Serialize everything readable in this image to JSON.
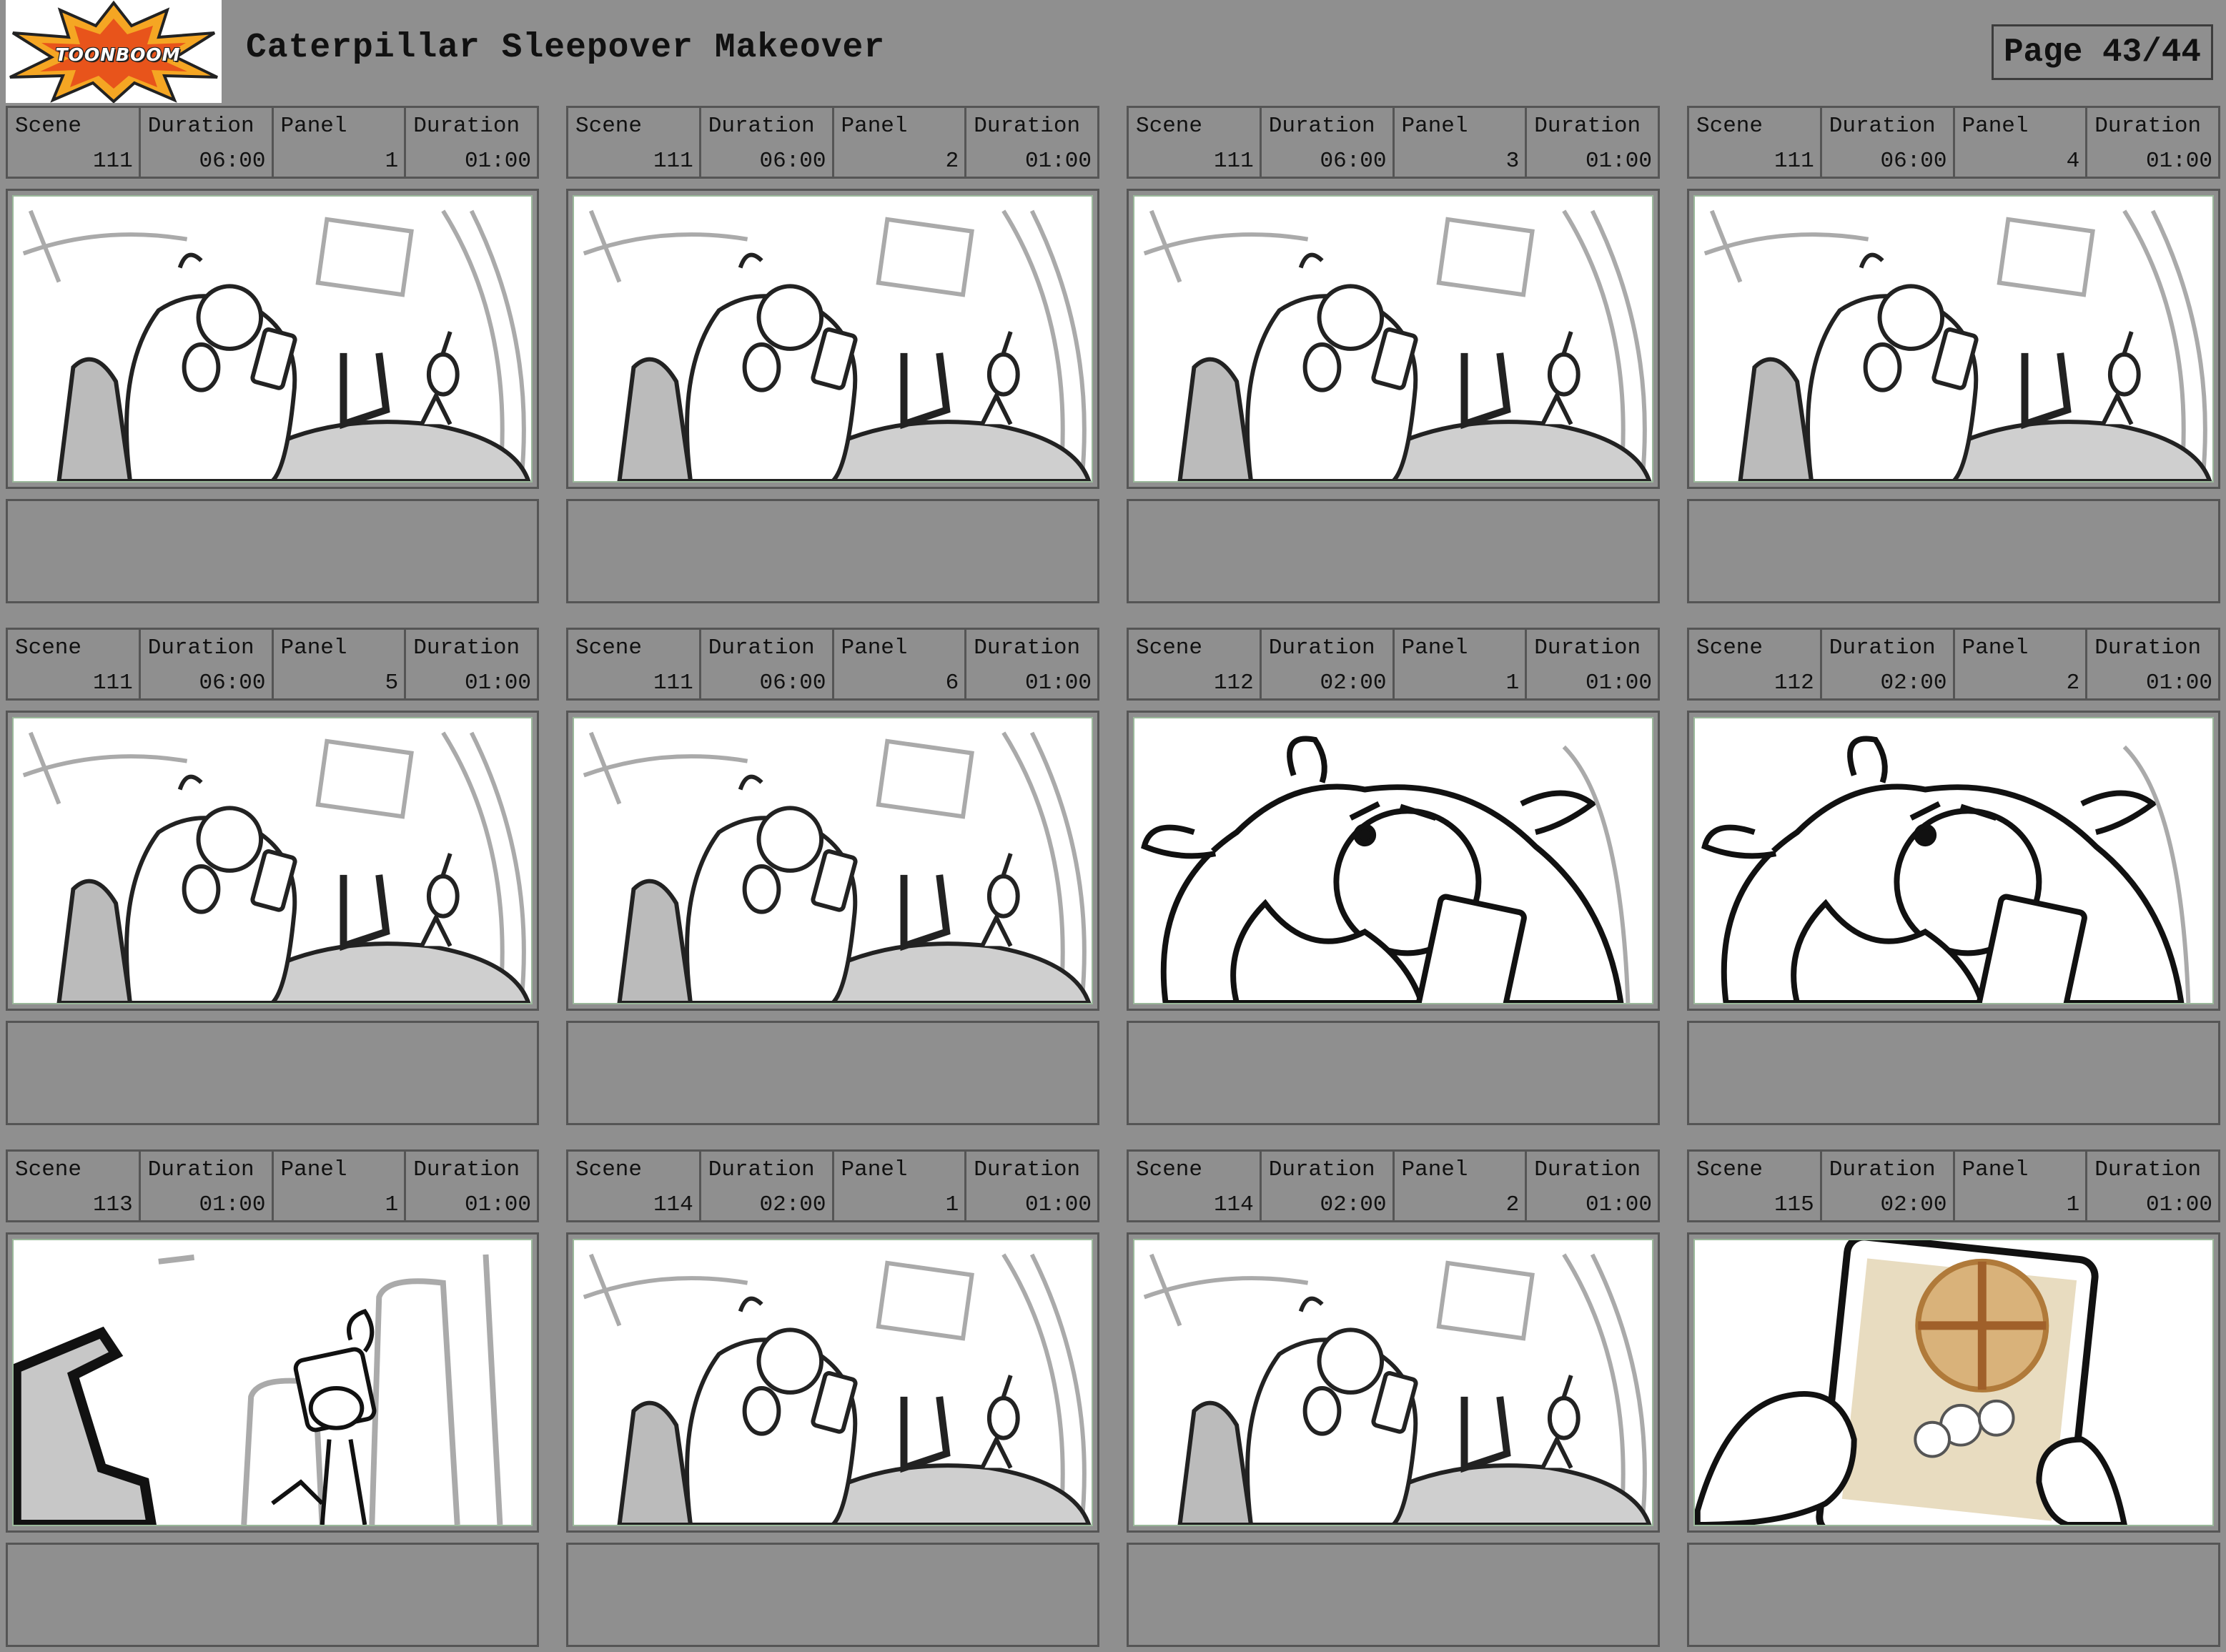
{
  "header": {
    "logo_text": "TOONBOOM",
    "title": "Caterpillar Sleepover Makeover",
    "page": "Page 43/44"
  },
  "labels": {
    "scene": "Scene",
    "duration": "Duration",
    "panel": "Panel"
  },
  "panels": [
    {
      "scene": "111",
      "scene_duration": "06:00",
      "panel": "1",
      "panel_duration": "01:00",
      "shot": "wide"
    },
    {
      "scene": "111",
      "scene_duration": "06:00",
      "panel": "2",
      "panel_duration": "01:00",
      "shot": "wide"
    },
    {
      "scene": "111",
      "scene_duration": "06:00",
      "panel": "3",
      "panel_duration": "01:00",
      "shot": "wide"
    },
    {
      "scene": "111",
      "scene_duration": "06:00",
      "panel": "4",
      "panel_duration": "01:00",
      "shot": "wide"
    },
    {
      "scene": "111",
      "scene_duration": "06:00",
      "panel": "5",
      "panel_duration": "01:00",
      "shot": "wide"
    },
    {
      "scene": "111",
      "scene_duration": "06:00",
      "panel": "6",
      "panel_duration": "01:00",
      "shot": "wide"
    },
    {
      "scene": "112",
      "scene_duration": "02:00",
      "panel": "1",
      "panel_duration": "01:00",
      "shot": "closeup"
    },
    {
      "scene": "112",
      "scene_duration": "02:00",
      "panel": "2",
      "panel_duration": "01:00",
      "shot": "closeup"
    },
    {
      "scene": "113",
      "scene_duration": "01:00",
      "panel": "1",
      "panel_duration": "01:00",
      "shot": "caterpillar"
    },
    {
      "scene": "114",
      "scene_duration": "02:00",
      "panel": "1",
      "panel_duration": "01:00",
      "shot": "wide"
    },
    {
      "scene": "114",
      "scene_duration": "02:00",
      "panel": "2",
      "panel_duration": "01:00",
      "shot": "wide"
    },
    {
      "scene": "115",
      "scene_duration": "02:00",
      "panel": "1",
      "panel_duration": "01:00",
      "shot": "phone"
    }
  ]
}
